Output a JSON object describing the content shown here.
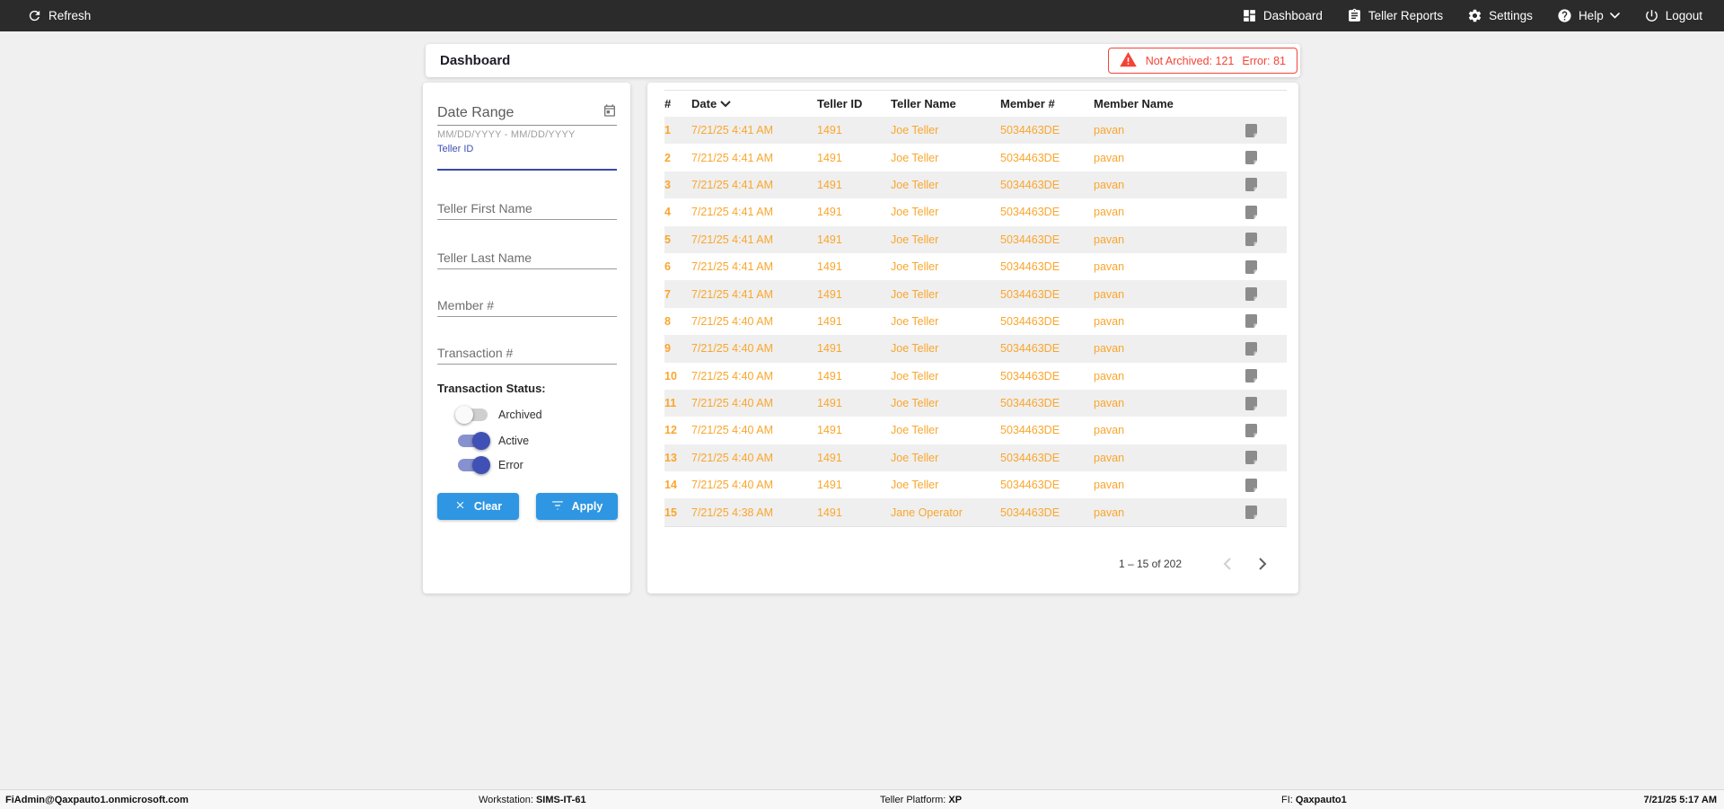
{
  "navbar": {
    "refresh_label": "Refresh",
    "items": [
      {
        "label": "Dashboard",
        "icon": "dashboard-icon"
      },
      {
        "label": "Teller Reports",
        "icon": "reports-icon"
      },
      {
        "label": "Settings",
        "icon": "settings-icon"
      },
      {
        "label": "Help",
        "icon": "help-icon"
      },
      {
        "label": "Logout",
        "icon": "logout-icon"
      }
    ]
  },
  "titlebar": {
    "title": "Dashboard",
    "alerts": {
      "not_archived": "Not Archived: 121",
      "error": "Error: 81"
    }
  },
  "filters": {
    "date_range_label": "Date Range",
    "date_range_hint": "MM/DD/YYYY - MM/DD/YYYY",
    "teller_id_label": "Teller ID",
    "teller_id_value": "",
    "teller_first_name_placeholder": "Teller First Name",
    "teller_last_name_placeholder": "Teller Last Name",
    "member_number_placeholder": "Member #",
    "transaction_number_placeholder": "Transaction #",
    "status_label": "Transaction Status:",
    "toggles": [
      {
        "label": "Archived",
        "on": false
      },
      {
        "label": "Active",
        "on": true
      },
      {
        "label": "Error",
        "on": true
      }
    ],
    "clear_label": "Clear",
    "apply_label": "Apply"
  },
  "table": {
    "columns": [
      "#",
      "Date",
      "Teller ID",
      "Teller Name",
      "Member #",
      "Member Name"
    ],
    "sorted_by": "Date",
    "rows": [
      {
        "num": "1",
        "date": "7/21/25 4:41 AM",
        "teller_id": "1491",
        "teller_name": "Joe Teller",
        "member_number": "5034463DE",
        "member_name": "pavan"
      },
      {
        "num": "2",
        "date": "7/21/25 4:41 AM",
        "teller_id": "1491",
        "teller_name": "Joe Teller",
        "member_number": "5034463DE",
        "member_name": "pavan"
      },
      {
        "num": "3",
        "date": "7/21/25 4:41 AM",
        "teller_id": "1491",
        "teller_name": "Joe Teller",
        "member_number": "5034463DE",
        "member_name": "pavan"
      },
      {
        "num": "4",
        "date": "7/21/25 4:41 AM",
        "teller_id": "1491",
        "teller_name": "Joe Teller",
        "member_number": "5034463DE",
        "member_name": "pavan"
      },
      {
        "num": "5",
        "date": "7/21/25 4:41 AM",
        "teller_id": "1491",
        "teller_name": "Joe Teller",
        "member_number": "5034463DE",
        "member_name": "pavan"
      },
      {
        "num": "6",
        "date": "7/21/25 4:41 AM",
        "teller_id": "1491",
        "teller_name": "Joe Teller",
        "member_number": "5034463DE",
        "member_name": "pavan"
      },
      {
        "num": "7",
        "date": "7/21/25 4:41 AM",
        "teller_id": "1491",
        "teller_name": "Joe Teller",
        "member_number": "5034463DE",
        "member_name": "pavan"
      },
      {
        "num": "8",
        "date": "7/21/25 4:40 AM",
        "teller_id": "1491",
        "teller_name": "Joe Teller",
        "member_number": "5034463DE",
        "member_name": "pavan"
      },
      {
        "num": "9",
        "date": "7/21/25 4:40 AM",
        "teller_id": "1491",
        "teller_name": "Joe Teller",
        "member_number": "5034463DE",
        "member_name": "pavan"
      },
      {
        "num": "10",
        "date": "7/21/25 4:40 AM",
        "teller_id": "1491",
        "teller_name": "Joe Teller",
        "member_number": "5034463DE",
        "member_name": "pavan"
      },
      {
        "num": "11",
        "date": "7/21/25 4:40 AM",
        "teller_id": "1491",
        "teller_name": "Joe Teller",
        "member_number": "5034463DE",
        "member_name": "pavan"
      },
      {
        "num": "12",
        "date": "7/21/25 4:40 AM",
        "teller_id": "1491",
        "teller_name": "Joe Teller",
        "member_number": "5034463DE",
        "member_name": "pavan"
      },
      {
        "num": "13",
        "date": "7/21/25 4:40 AM",
        "teller_id": "1491",
        "teller_name": "Joe Teller",
        "member_number": "5034463DE",
        "member_name": "pavan"
      },
      {
        "num": "14",
        "date": "7/21/25 4:40 AM",
        "teller_id": "1491",
        "teller_name": "Joe Teller",
        "member_number": "5034463DE",
        "member_name": "pavan"
      },
      {
        "num": "15",
        "date": "7/21/25 4:38 AM",
        "teller_id": "1491",
        "teller_name": "Jane Operator",
        "member_number": "5034463DE",
        "member_name": "pavan"
      }
    ],
    "pagination": {
      "range": "1 – 15 of 202"
    }
  },
  "statusbar": {
    "user": "FiAdmin@Qaxpauto1.onmicrosoft.com",
    "workstation_label": "Workstation:",
    "workstation": "SIMS-IT-61",
    "platform_label": "Teller Platform:",
    "platform": "XP",
    "fi_label": "FI:",
    "fi": "Qaxpauto1",
    "datetime": "7/21/25 5:17 AM"
  },
  "colors": {
    "navbar_bg": "#2b2b2b",
    "accent_blue": "#2e96e2",
    "indigo": "#3f51b5",
    "row_orange": "#faa62d",
    "alert_red": "#f44336",
    "row_alt_bg": "#efefef"
  }
}
